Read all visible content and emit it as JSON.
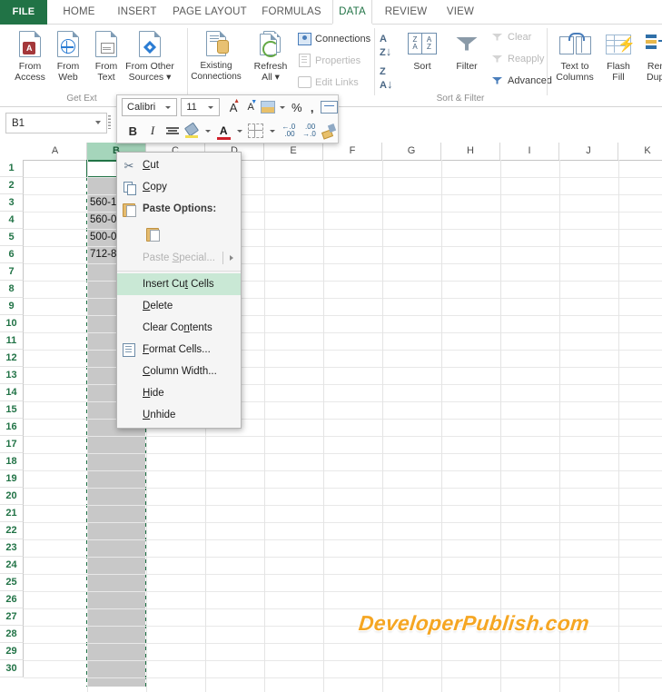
{
  "ribbon": {
    "tabs": [
      {
        "label": "FILE",
        "id": "file"
      },
      {
        "label": "HOME",
        "id": "home"
      },
      {
        "label": "INSERT",
        "id": "insert"
      },
      {
        "label": "PAGE LAYOUT",
        "id": "page-layout"
      },
      {
        "label": "FORMULAS",
        "id": "formulas"
      },
      {
        "label": "DATA",
        "id": "data"
      },
      {
        "label": "REVIEW",
        "id": "review"
      },
      {
        "label": "VIEW",
        "id": "view"
      }
    ],
    "active_tab": "DATA",
    "groups": {
      "get_external_data": {
        "label": "Get Ext",
        "buttons": [
          {
            "l1": "From",
            "l2": "Access"
          },
          {
            "l1": "From",
            "l2": "Web"
          },
          {
            "l1": "From",
            "l2": "Text"
          },
          {
            "l1": "From Other",
            "l2": "Sources ▾"
          }
        ]
      },
      "connections": {
        "label": "",
        "big": {
          "l1": "Refresh",
          "l2": "All ▾"
        },
        "items": [
          {
            "label": "Connections",
            "disabled": false
          },
          {
            "label": "Properties",
            "disabled": true
          },
          {
            "label": "Edit Links",
            "disabled": true
          }
        ]
      },
      "sort_filter": {
        "label": "Sort & Filter",
        "big": [
          {
            "l1": "Sort",
            "l2": ""
          },
          {
            "l1": "Filter",
            "l2": ""
          }
        ],
        "items": [
          {
            "label": "Clear",
            "disabled": true
          },
          {
            "label": "Reapply",
            "disabled": true
          },
          {
            "label": "Advanced",
            "disabled": false
          }
        ]
      },
      "data_tools": {
        "label": "",
        "buttons": [
          {
            "l1": "Text to",
            "l2": "Columns"
          },
          {
            "l1": "Flash",
            "l2": "Fill"
          },
          {
            "l1": "Rem",
            "l2": "Dupli"
          }
        ]
      }
    }
  },
  "minitoolbar": {
    "font_name": "Calibri",
    "font_size": "11",
    "grow_font": "A",
    "shrink_font": "A",
    "percent": "%",
    "comma": ",",
    "bold": "B",
    "italic": "I",
    "font_color_letter": "A"
  },
  "namebox": {
    "value": "B1"
  },
  "grid": {
    "columns": [
      "A",
      "B",
      "C",
      "D",
      "E",
      "F",
      "G",
      "H",
      "I",
      "J",
      "K"
    ],
    "selected_column": "B",
    "rows": [
      "1",
      "2",
      "3",
      "4",
      "5",
      "6",
      "7",
      "8",
      "9",
      "10",
      "11",
      "12",
      "13",
      "14",
      "15",
      "16",
      "17",
      "18",
      "19",
      "20",
      "21",
      "22",
      "23",
      "24",
      "25",
      "26",
      "27",
      "28",
      "29",
      "30"
    ],
    "cells": [
      {
        "ref": "B3",
        "value": "560-1"
      },
      {
        "ref": "B4",
        "value": "560-0"
      },
      {
        "ref": "B5",
        "value": "500-0"
      },
      {
        "ref": "B6",
        "value": "712-8"
      }
    ]
  },
  "context_menu": {
    "items": [
      {
        "label": "Cut",
        "icon": "scissors-icon",
        "state": "normal"
      },
      {
        "label": "Copy",
        "icon": "copy-icon",
        "state": "normal"
      },
      {
        "label": "Paste Options:",
        "icon": "paste-icon",
        "state": "header"
      },
      {
        "label": "",
        "icon": "paste-clipboard-icon",
        "state": "icononly"
      },
      {
        "label": "Paste Special...",
        "icon": "",
        "state": "disabled",
        "submenu": true
      },
      {
        "label": "Insert Cut Cells",
        "icon": "",
        "state": "highlighted"
      },
      {
        "label": "Delete",
        "icon": "",
        "state": "normal"
      },
      {
        "label": "Clear Contents",
        "icon": "",
        "state": "normal"
      },
      {
        "label": "Format Cells...",
        "icon": "format-cells-icon",
        "state": "normal"
      },
      {
        "label": "Column Width...",
        "icon": "",
        "state": "normal"
      },
      {
        "label": "Hide",
        "icon": "",
        "state": "normal"
      },
      {
        "label": "Unhide",
        "icon": "",
        "state": "normal"
      }
    ]
  },
  "watermark": {
    "text": "DeveloperPublish.com"
  },
  "colors": {
    "excel_green": "#217346",
    "selection_green": "#a5d5bb",
    "highlight_green": "#c9e8d5",
    "watermark_orange": "#f5a623",
    "column_selected_gray": "#c8c8c8"
  }
}
